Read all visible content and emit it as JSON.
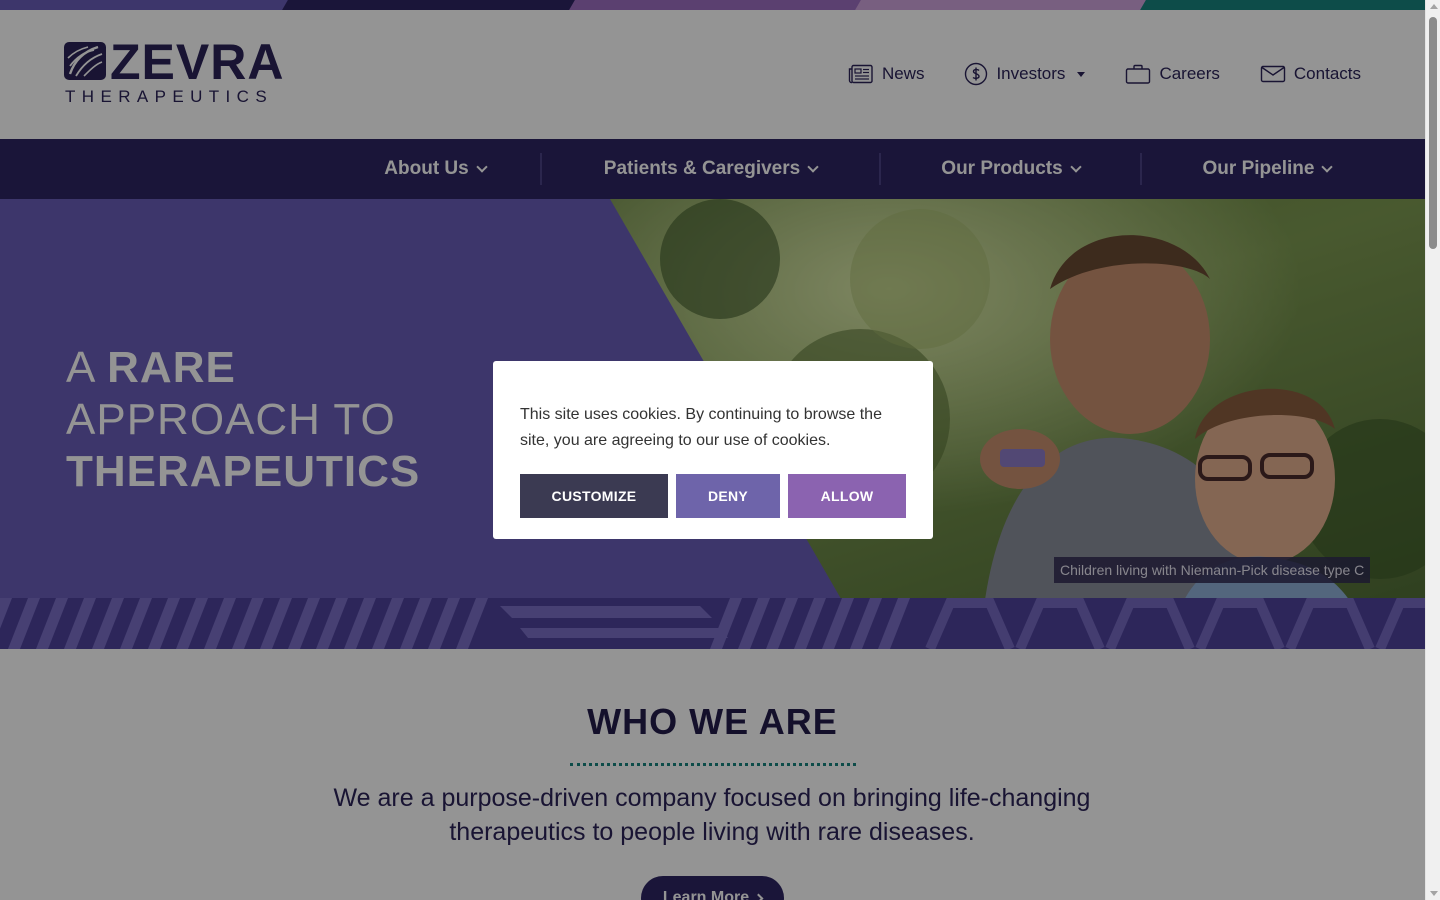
{
  "colors": {
    "brand_navy": "#2d2563",
    "hero_purple": "#6a5db8",
    "teal_accent": "#17847f",
    "customize_btn": "#3b3a52",
    "deny_btn": "#6e64aa",
    "allow_btn": "#8b63b0",
    "topbar": [
      "#6a5db8",
      "#2d2563",
      "#8b5ab8",
      "#c99ad6",
      "#17847f"
    ]
  },
  "header": {
    "logo": {
      "name": "ZEVRA",
      "tagline": "THERAPEUTICS",
      "icon": "leaf-mark-icon"
    },
    "utility_nav": [
      {
        "label": "News",
        "icon": "newspaper-icon"
      },
      {
        "label": "Investors",
        "icon": "dollar-circle-icon",
        "has_dropdown": true
      },
      {
        "label": "Careers",
        "icon": "briefcase-icon"
      },
      {
        "label": "Contacts",
        "icon": "envelope-icon"
      }
    ]
  },
  "main_nav": [
    {
      "label": "About Us"
    },
    {
      "label": "Patients & Caregivers"
    },
    {
      "label": "Our Products"
    },
    {
      "label": "Our Pipeline"
    }
  ],
  "hero": {
    "line1_light": "A ",
    "line1_bold": "RARE",
    "line2": "APPROACH TO",
    "line3": "THERAPEUTICS",
    "caption": "Children living with Niemann-Pick disease type C"
  },
  "who_we_are": {
    "heading": "WHO WE ARE",
    "body": "We are a purpose-driven company focused on bringing life-changing therapeutics to people living with rare diseases.",
    "cta": "Learn More"
  },
  "cookie_banner": {
    "message": "This site uses cookies. By continuing to browse the site, you are agreeing to our use of cookies.",
    "customize": "CUSTOMIZE",
    "deny": "DENY",
    "allow": "ALLOW"
  }
}
